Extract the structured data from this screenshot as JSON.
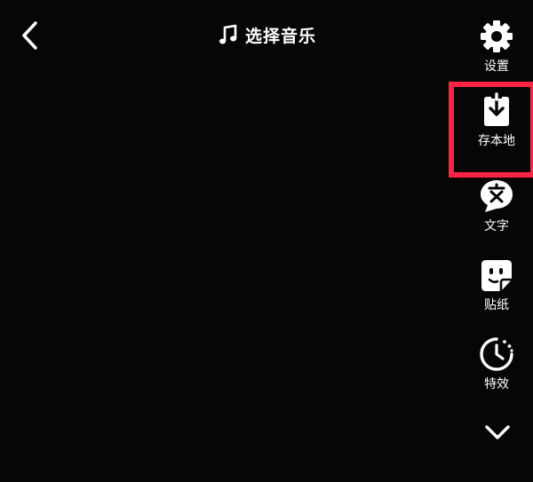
{
  "header": {
    "music_label": "选择音乐"
  },
  "tools": {
    "settings_label": "设置",
    "save_label": "存本地",
    "text_label": "文字",
    "sticker_label": "贴纸",
    "effects_label": "特效"
  },
  "icons": {
    "back": "chevron-left-icon",
    "music": "music-note-icon",
    "settings": "gear-icon",
    "save": "download-icon",
    "text": "text-bubble-icon",
    "sticker": "sticker-icon",
    "effects": "timer-icon",
    "expand": "chevron-down-icon"
  },
  "colors": {
    "background": "#060606",
    "highlight": "#ff2446",
    "foreground": "#ffffff"
  }
}
